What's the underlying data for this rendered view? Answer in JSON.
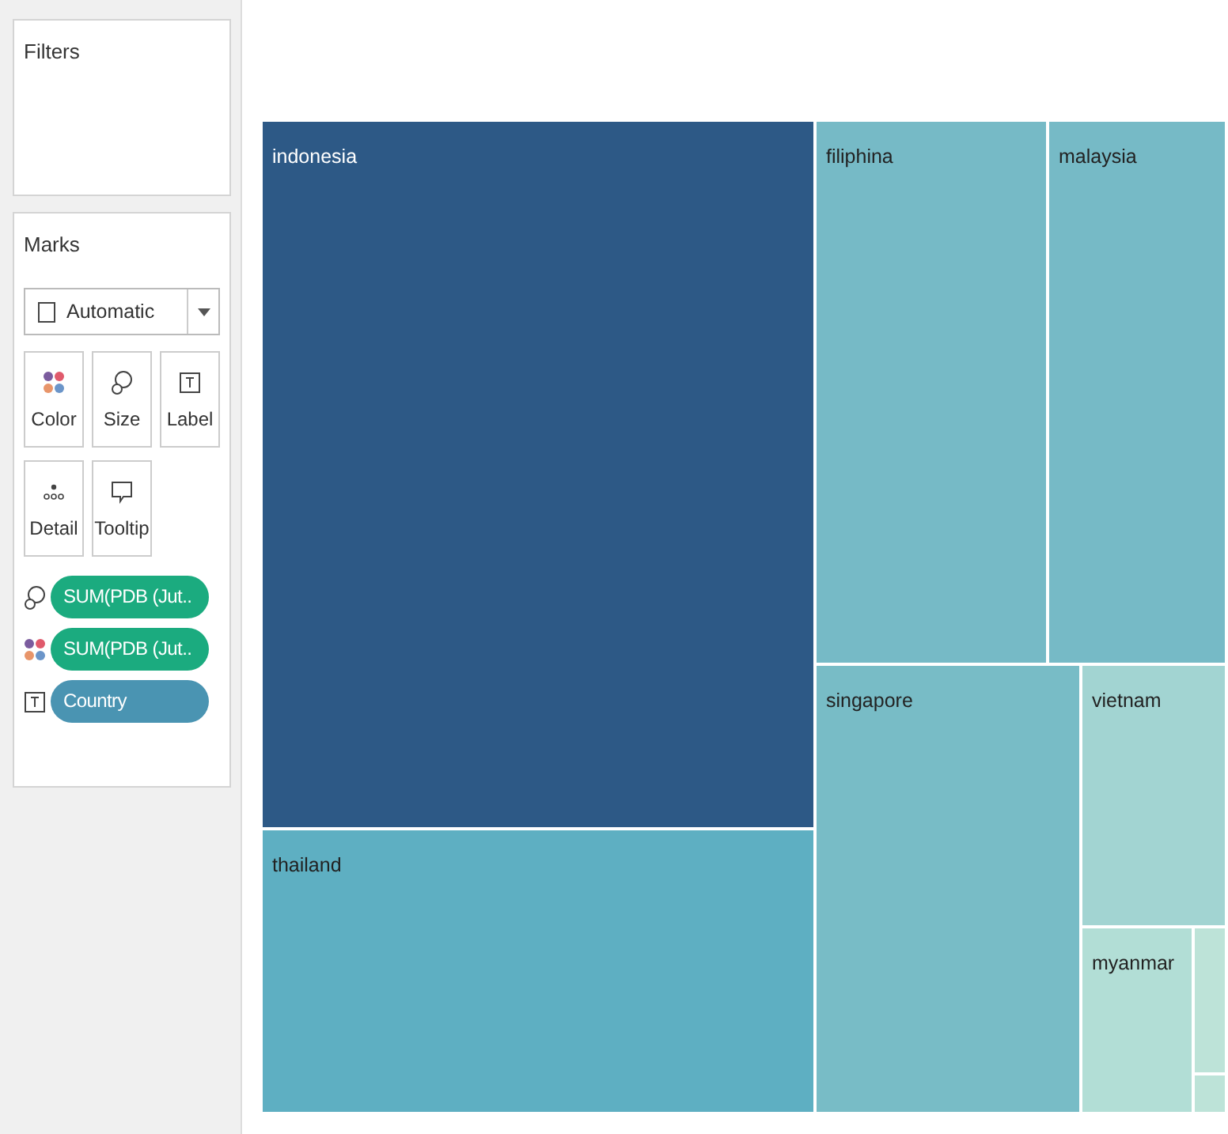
{
  "filters": {
    "title": "Filters"
  },
  "marks": {
    "title": "Marks",
    "mark_type": "Automatic",
    "buttons": [
      {
        "label": "Color",
        "kind": "color"
      },
      {
        "label": "Size",
        "kind": "size"
      },
      {
        "label": "Label",
        "kind": "label"
      },
      {
        "label": "Detail",
        "kind": "detail"
      },
      {
        "label": "Tooltip",
        "kind": "tooltip"
      }
    ],
    "pills": [
      {
        "kind": "size",
        "label": "SUM(PDB (Jut..",
        "color": "#1bab7f"
      },
      {
        "kind": "color",
        "label": "SUM(PDB (Jut..",
        "color": "#1bab7f"
      },
      {
        "kind": "label",
        "label": "Country",
        "color": "#4a94b2"
      }
    ]
  },
  "treemap": {
    "tiles": [
      {
        "label": "indonesia",
        "color": "#2d5986"
      },
      {
        "label": "thailand",
        "color": "#5eafc2"
      },
      {
        "label": "filiphina",
        "color": "#76bac6"
      },
      {
        "label": "malaysia",
        "color": "#76bac6"
      },
      {
        "label": "singapore",
        "color": "#78bcc6"
      },
      {
        "label": "vietnam",
        "color": "#a2d4d2"
      },
      {
        "label": "myanmar",
        "color": "#b2ded6"
      },
      {
        "color": "#bde3d8"
      },
      {
        "color": "#bde3d8"
      }
    ]
  }
}
